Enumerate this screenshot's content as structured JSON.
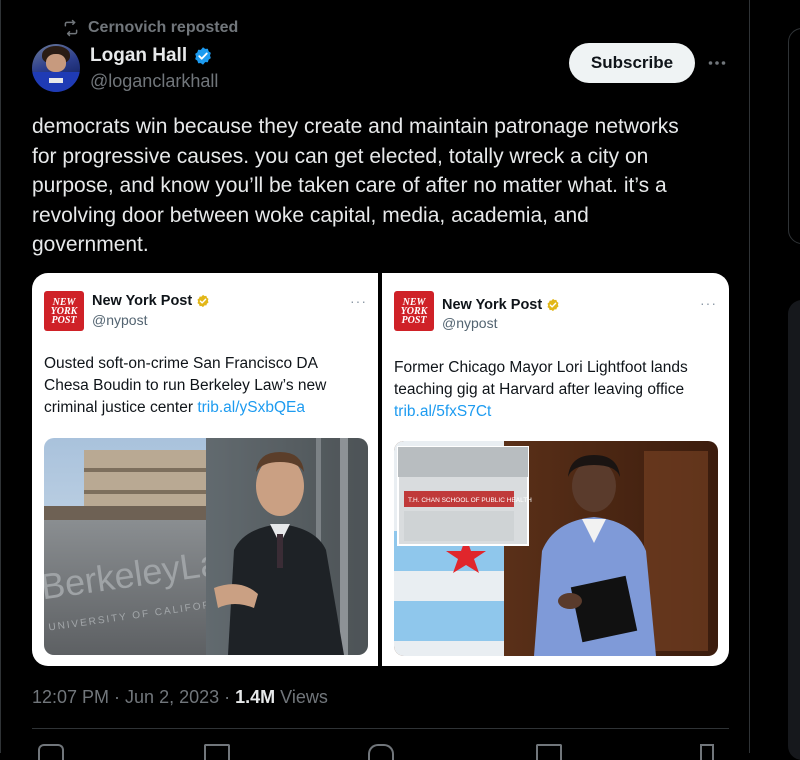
{
  "repost": {
    "label": "Cernovich reposted",
    "icon": "repost-icon"
  },
  "author": {
    "name": "Logan Hall",
    "handle": "@loganclarkhall",
    "verified_icon": "verified-badge-icon"
  },
  "subscribe_label": "Subscribe",
  "more_label": "···",
  "tweet_lines": [
    "democrats win because they create and maintain patronage networks",
    "for progressive causes. you can get elected, totally wreck a city on",
    "purpose, and know you’ll be taken care of after no matter what. it’s a",
    "revolving door between woke capital, media, academia, and",
    "government."
  ],
  "embedded": [
    {
      "logo": [
        "NEW",
        "YORK",
        "POST"
      ],
      "name": "New York Post",
      "handle": "@nypost",
      "dots": "···",
      "lines": [
        "Ousted soft-on-crime San Francisco DA",
        "Chesa Boudin to run Berkeley Law’s new",
        "criminal justice center "
      ],
      "link": "trib.al/ySxbQEa",
      "sign_text": "BerkeleyLaw",
      "sign_sub": "UNIVERSITY OF CALIFOR"
    },
    {
      "logo": [
        "NEW",
        "YORK",
        "POST"
      ],
      "name": "New York Post",
      "handle": "@nypost",
      "dots": "···",
      "lines": [
        "Former Chicago Mayor Lori Lightfoot lands",
        "teaching gig at Harvard after leaving office"
      ],
      "link": "trib.al/5fxS7Ct",
      "sign_text": "T.H. CHAN SCHOOL OF PUBLIC HEALTH"
    }
  ],
  "meta": {
    "time": "12:07 PM",
    "sep1": " · ",
    "date": "Jun 2, 2023",
    "sep2": " · ",
    "views": "1.4M",
    "views_label": " Views"
  },
  "colors": {
    "accent": "#1d9bf0",
    "nyp_red": "#cf2127",
    "badge_gold": "#e2b719"
  }
}
